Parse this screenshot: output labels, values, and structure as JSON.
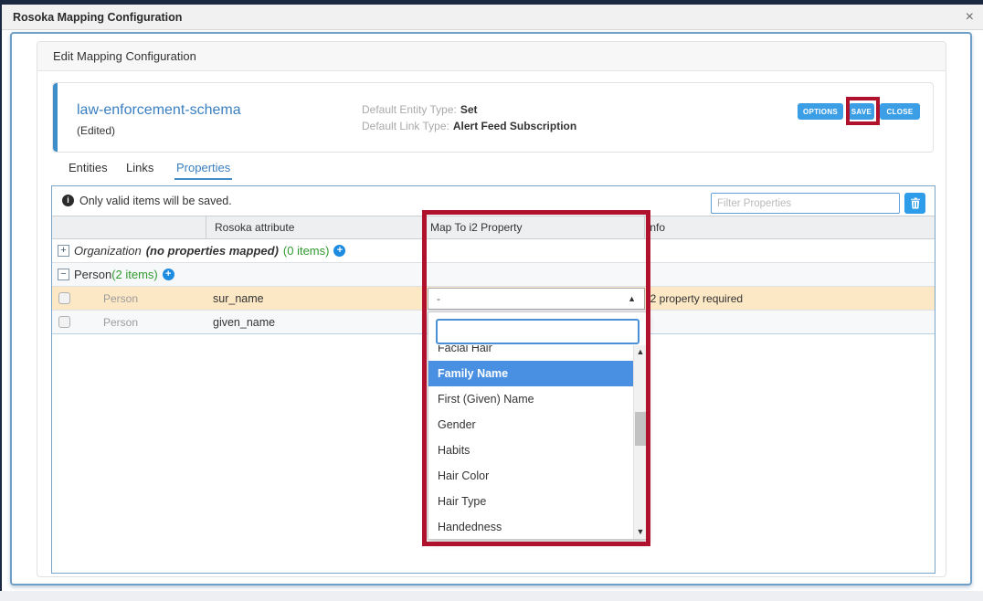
{
  "window": {
    "title": "Rosoka Mapping Configuration",
    "close": "×"
  },
  "card": {
    "header": "Edit Mapping Configuration"
  },
  "schema": {
    "name": "law-enforcement-schema",
    "status": "(Edited)",
    "defaults": [
      {
        "label": "Default Entity Type:",
        "value": "Set"
      },
      {
        "label": "Default Link Type:",
        "value": "Alert Feed Subscription"
      }
    ],
    "buttons": [
      {
        "label": "OPTIONS"
      },
      {
        "label": "SAVE"
      },
      {
        "label": "CLOSE"
      }
    ]
  },
  "tabs": [
    {
      "label": "Entities"
    },
    {
      "label": "Links"
    },
    {
      "label": "Properties",
      "active": true
    }
  ],
  "notice": {
    "icon": "i",
    "text": "Only valid items will be saved."
  },
  "filter": {
    "placeholder": "Filter Properties"
  },
  "columns": [
    {
      "label": ""
    },
    {
      "label": "Rosoka attribute"
    },
    {
      "label": "Map To i2 Property"
    },
    {
      "label": "Info"
    }
  ],
  "groups": [
    {
      "toggle": "+",
      "name": "Organization",
      "detail": "(no properties mapped)",
      "count": "(0 items)",
      "add": "+"
    },
    {
      "toggle": "−",
      "name": "Person",
      "count": "(2 items)",
      "add": "+"
    }
  ],
  "rows": [
    {
      "type": "Person",
      "attribute": "sur_name",
      "value": "-",
      "info": "i2 property required"
    },
    {
      "type": "Person",
      "attribute": "given_name"
    }
  ],
  "dropdown": {
    "search_value": "",
    "items": [
      "Facial Hair",
      "Family Name",
      "First (Given) Name",
      "Gender",
      "Habits",
      "Hair Color",
      "Hair Type",
      "Handedness"
    ],
    "selected": "Family Name"
  },
  "icons": {
    "dropdown_open": "▲",
    "scroll_up": "▲",
    "scroll_down": "▼"
  },
  "colors": {
    "accent": "#3e8ec9",
    "button": "#3c9fe6",
    "annotation": "#b0122d",
    "selected": "#4a90e2",
    "green": "#2f9a2f",
    "link": "#3a7fc1",
    "highlight_row": "#fce8c5",
    "titlebar_top": "#1b2940"
  }
}
